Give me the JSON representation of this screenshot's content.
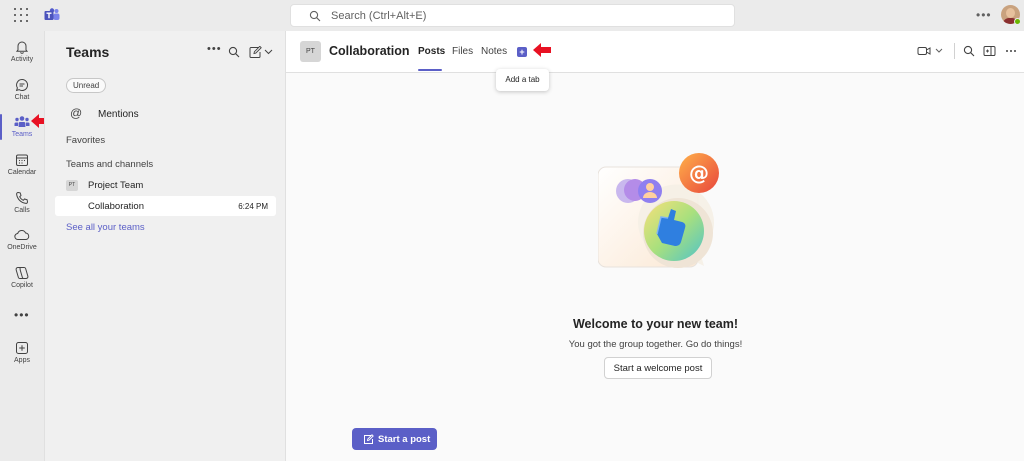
{
  "topbar": {
    "search_placeholder": "Search (Ctrl+Alt+E)",
    "more_label": "•••"
  },
  "rail": {
    "items": [
      {
        "label": "Activity",
        "icon": "bell-icon"
      },
      {
        "label": "Chat",
        "icon": "chat-icon"
      },
      {
        "label": "Teams",
        "icon": "teams-icon",
        "active": true
      },
      {
        "label": "Calendar",
        "icon": "calendar-icon"
      },
      {
        "label": "Calls",
        "icon": "phone-icon"
      },
      {
        "label": "OneDrive",
        "icon": "cloud-icon"
      },
      {
        "label": "Copilot",
        "icon": "copilot-icon"
      },
      {
        "label": "Apps",
        "icon": "apps-plus-icon"
      }
    ],
    "more_label": "•••"
  },
  "panel": {
    "title": "Teams",
    "more_label": "•••",
    "unread_filter": "Unread",
    "mentions_label": "Mentions",
    "favorites_label": "Favorites",
    "teams_channels_label": "Teams and channels",
    "team": {
      "avatar_text": "PT",
      "name": "Project Team"
    },
    "channel": {
      "name": "Collaboration",
      "time": "6:24 PM"
    },
    "see_all": "See all your teams"
  },
  "main": {
    "channel_avatar": "PT",
    "channel_title": "Collaboration",
    "tabs": [
      {
        "label": "Posts",
        "active": true
      },
      {
        "label": "Files"
      },
      {
        "label": "Notes"
      }
    ],
    "add_tab_symbol": "+",
    "add_tab_tooltip": "Add a tab",
    "welcome_title": "Welcome to your new team!",
    "welcome_subtitle": "You got the group together. Go do things!",
    "welcome_button": "Start a welcome post",
    "start_post_button": "Start a post"
  },
  "colors": {
    "accent": "#5b5fc7",
    "annotation_arrow": "#e81123",
    "presence_available": "#6bb700"
  }
}
